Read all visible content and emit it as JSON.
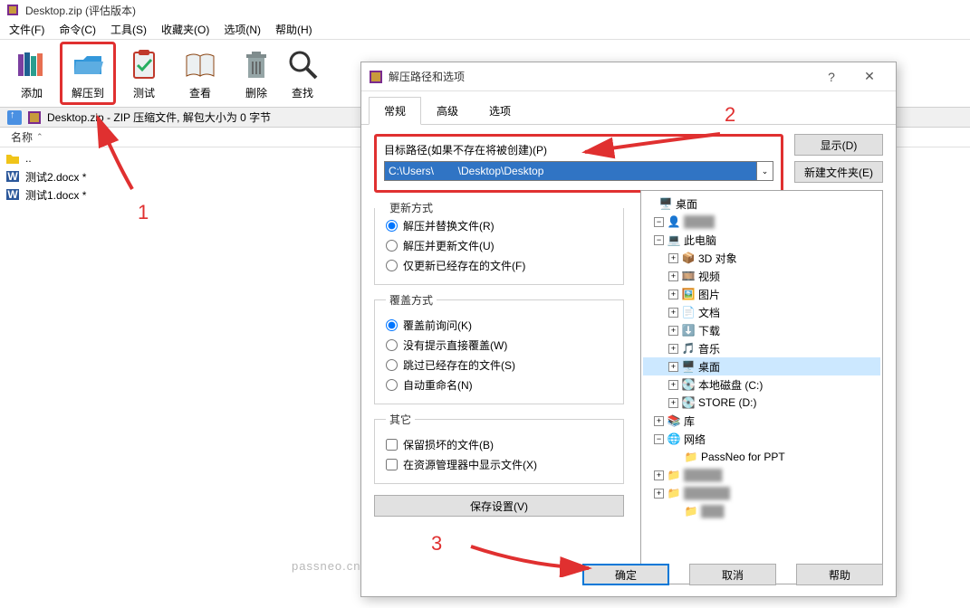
{
  "window": {
    "title": "Desktop.zip (评估版本)"
  },
  "menus": [
    "文件(F)",
    "命令(C)",
    "工具(S)",
    "收藏夹(O)",
    "选项(N)",
    "帮助(H)"
  ],
  "toolbar": {
    "add": "添加",
    "extract_to": "解压到",
    "test": "测试",
    "view": "查看",
    "delete": "删除",
    "find_partial": "查找"
  },
  "infobar": {
    "text": "Desktop.zip - ZIP 压缩文件, 解包大小为 0 字节"
  },
  "list": {
    "col_name": "名称",
    "rows": [
      {
        "name": "..",
        "type": "folder"
      },
      {
        "name": "测试2.docx *",
        "type": "docx"
      },
      {
        "name": "测试1.docx *",
        "type": "docx"
      }
    ]
  },
  "dialog": {
    "title": "解压路径和选项",
    "help_glyph": "?",
    "close_glyph": "✕",
    "tabs": {
      "general": "常规",
      "advanced": "高级",
      "options": "选项"
    },
    "path_label": "目标路径(如果不存在将被创建)(P)",
    "path_value": "C:\\Users\\        \\Desktop\\Desktop",
    "btn_show": "显示(D)",
    "btn_newfolder": "新建文件夹(E)",
    "update": {
      "legend": "更新方式",
      "r1": "解压并替换文件(R)",
      "r2": "解压并更新文件(U)",
      "r3": "仅更新已经存在的文件(F)"
    },
    "overwrite": {
      "legend": "覆盖方式",
      "r1": "覆盖前询问(K)",
      "r2": "没有提示直接覆盖(W)",
      "r3": "跳过已经存在的文件(S)",
      "r4": "自动重命名(N)"
    },
    "misc": {
      "legend": "其它",
      "c1": "保留损坏的文件(B)",
      "c2": "在资源管理器中显示文件(X)"
    },
    "save_settings": "保存设置(V)",
    "tree": {
      "desktop": "桌面",
      "thispc": "此电脑",
      "objects3d": "3D 对象",
      "videos": "视频",
      "pictures": "图片",
      "documents": "文档",
      "downloads": "下载",
      "music": "音乐",
      "desktop2": "桌面",
      "localdisk": "本地磁盘 (C:)",
      "store": "STORE (D:)",
      "libraries": "库",
      "network": "网络",
      "passneo": "PassNeo for PPT"
    },
    "ok": "确定",
    "cancel": "取消",
    "help": "帮助"
  },
  "annotations": {
    "n1": "1",
    "n2": "2",
    "n3": "3"
  },
  "watermark": "passneo.cn"
}
